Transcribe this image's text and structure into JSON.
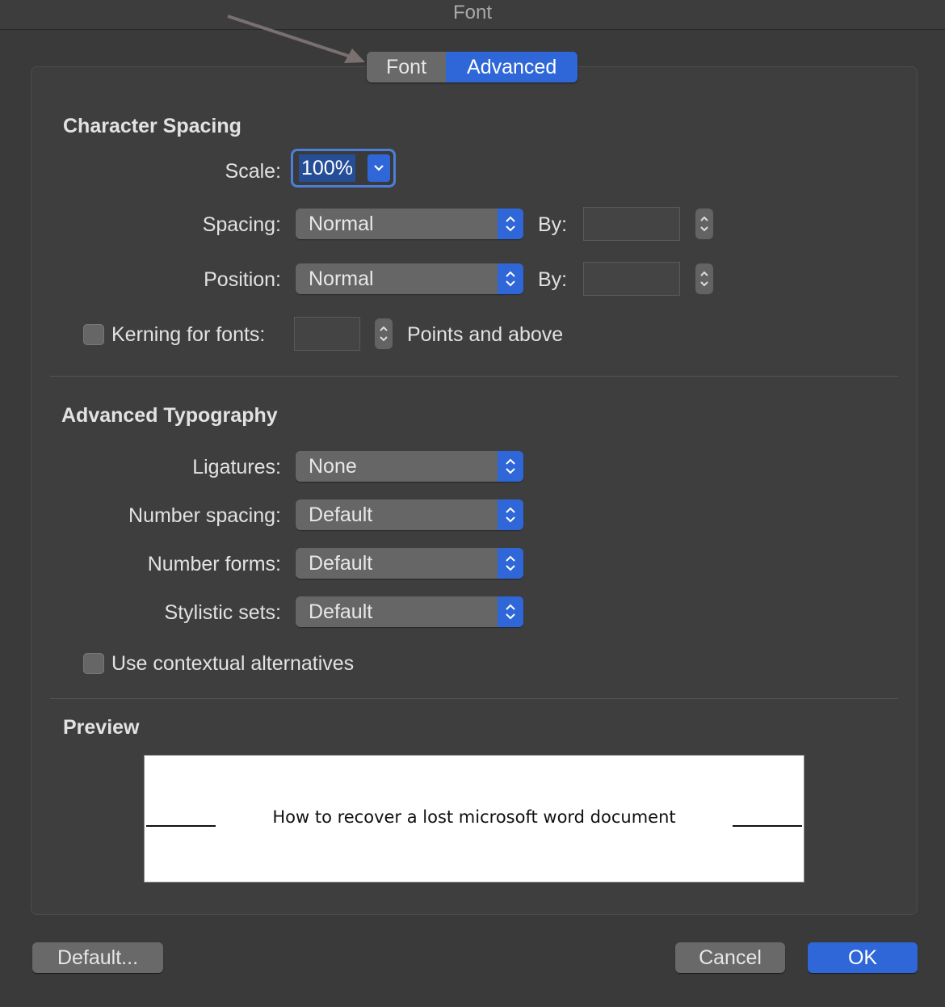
{
  "window": {
    "title": "Font"
  },
  "tabs": [
    {
      "label": "Font"
    },
    {
      "label": "Advanced"
    }
  ],
  "character_spacing": {
    "title": "Character Spacing",
    "scale": {
      "label": "Scale:",
      "value": "100%"
    },
    "spacing": {
      "label": "Spacing:",
      "value": "Normal",
      "by_label": "By:"
    },
    "position": {
      "label": "Position:",
      "value": "Normal",
      "by_label": "By:"
    },
    "kerning": {
      "label": "Kerning for fonts:",
      "suffix": "Points and above"
    }
  },
  "advanced_typography": {
    "title": "Advanced Typography",
    "ligatures": {
      "label": "Ligatures:",
      "value": "None"
    },
    "number_spacing": {
      "label": "Number spacing:",
      "value": "Default"
    },
    "number_forms": {
      "label": "Number forms:",
      "value": "Default"
    },
    "stylistic_sets": {
      "label": "Stylistic sets:",
      "value": "Default"
    },
    "contextual": {
      "label": "Use contextual alternatives"
    }
  },
  "preview": {
    "title": "Preview",
    "text": "How to recover a lost microsoft word document"
  },
  "buttons": {
    "default": "Default...",
    "cancel": "Cancel",
    "ok": "OK"
  },
  "colors": {
    "accent": "#2f67d8",
    "background": "#3a3a3b"
  }
}
